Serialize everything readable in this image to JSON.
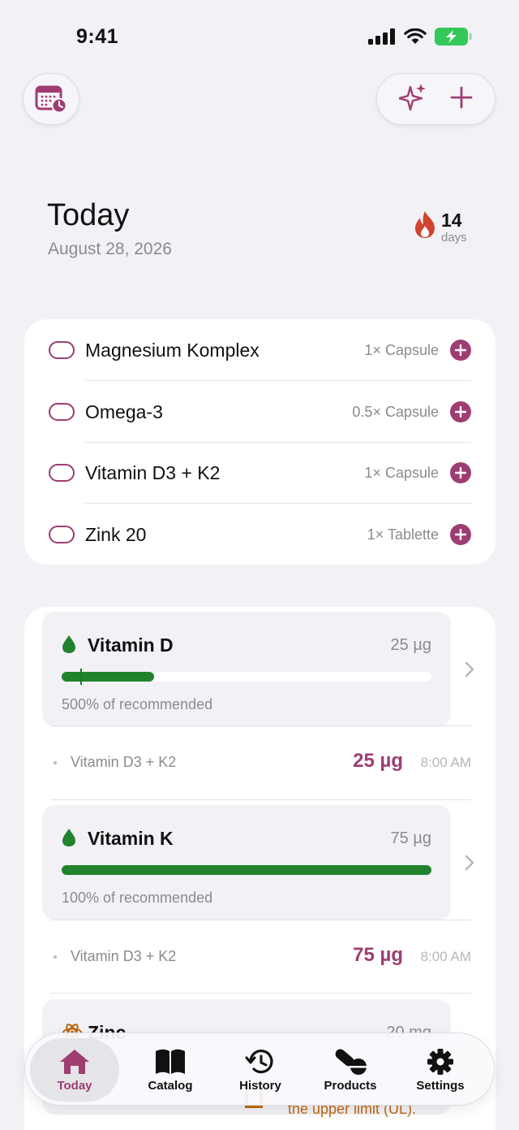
{
  "status": {
    "time": "9:41"
  },
  "header": {
    "title": "Today",
    "date": "August 28, 2026"
  },
  "streak": {
    "count": "14",
    "unit": "days"
  },
  "supplements": [
    {
      "name": "Magnesium Komplex",
      "dose": "1× Capsule"
    },
    {
      "name": "Omega-3",
      "dose": "0.5× Capsule"
    },
    {
      "name": "Vitamin D3 + K2",
      "dose": "1× Capsule"
    },
    {
      "name": "Zink 20",
      "dose": "1× Tablette"
    }
  ],
  "nutrients": [
    {
      "name": "Vitamin D",
      "amount": "25 µg",
      "percent_text": "500% of recommended",
      "bar_fraction": 0.25,
      "target_fraction": 0.05,
      "intake": {
        "source": "Vitamin D3 + K2",
        "amount": "25 µg",
        "time": "8:00 AM"
      }
    },
    {
      "name": "Vitamin K",
      "amount": "75 µg",
      "percent_text": "100% of recommended",
      "bar_fraction": 1.0,
      "intake": {
        "source": "Vitamin D3 + K2",
        "amount": "75 µg",
        "time": "8:00 AM"
      }
    },
    {
      "name": "Zinc",
      "amount": "20 mg"
    }
  ],
  "warning": {
    "text": "the upper limit (UL)."
  },
  "tabs": [
    {
      "label": "Today",
      "icon": "house-icon",
      "active": true
    },
    {
      "label": "Catalog",
      "icon": "book-icon"
    },
    {
      "label": "History",
      "icon": "history-icon"
    },
    {
      "label": "Products",
      "icon": "pills-icon"
    },
    {
      "label": "Settings",
      "icon": "gear-icon"
    }
  ],
  "colors": {
    "accent": "#9e3d72",
    "green": "#20822d",
    "warning": "#c0680f",
    "background": "#f2f1f6"
  }
}
